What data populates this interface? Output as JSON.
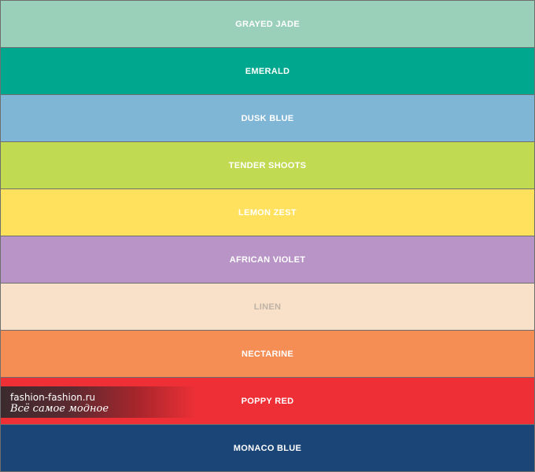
{
  "swatches": [
    {
      "name": "GRAYED JADE",
      "color": "#9ACFBA",
      "text_color": "#FFFFFF"
    },
    {
      "name": "EMERALD",
      "color": "#00A78F",
      "text_color": "#FFFFFF"
    },
    {
      "name": "DUSK BLUE",
      "color": "#7FB5D5",
      "text_color": "#FFFFFF"
    },
    {
      "name": "TENDER SHOOTS",
      "color": "#C0DA51",
      "text_color": "#FFFFFF"
    },
    {
      "name": "LEMON ZEST",
      "color": "#FFE15D",
      "text_color": "#FFFFFF"
    },
    {
      "name": "AFRICAN VIOLET",
      "color": "#B895C6",
      "text_color": "#FFFFFF"
    },
    {
      "name": "LINEN",
      "color": "#F8E1C8",
      "text_color": "#BFB2A6"
    },
    {
      "name": "NECTARINE",
      "color": "#F58E54",
      "text_color": "#FFFFFF"
    },
    {
      "name": "POPPY RED",
      "color": "#EE3036",
      "text_color": "#FFFFFF"
    },
    {
      "name": "MONACO BLUE",
      "color": "#1B4577",
      "text_color": "#FFFFFF"
    }
  ],
  "watermark": {
    "site": "fashion-fashion.ru",
    "tagline": "Всё самое модное"
  }
}
